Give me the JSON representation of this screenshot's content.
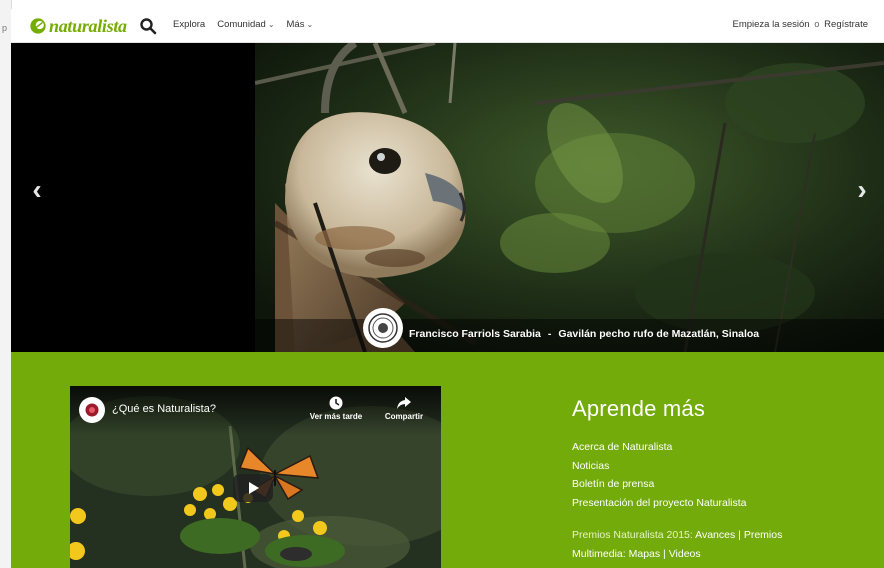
{
  "browser": {
    "edge_char": "p"
  },
  "header": {
    "logo_text": "naturalista",
    "nav": [
      {
        "label": "Explora",
        "dropdown": false
      },
      {
        "label": "Comunidad",
        "dropdown": true
      },
      {
        "label": "Más",
        "dropdown": true
      }
    ],
    "login": "Empieza la sesión",
    "or": "o",
    "signup": "Regístrate"
  },
  "hero": {
    "photographer": "Francisco Farriols Sarabia",
    "separator": "-",
    "description": "Gavilán pecho rufo de Mazatlán, Sinaloa",
    "prev_glyph": "‹",
    "next_glyph": "›"
  },
  "video": {
    "title": "¿Qué es Naturalista?",
    "watch_later": "Ver más tarde",
    "share": "Compartir"
  },
  "learn": {
    "heading": "Aprende más",
    "links": [
      "Acerca de Naturalista",
      "Noticias",
      "Boletín de prensa",
      "Presentación del proyecto Naturalista"
    ],
    "awards": {
      "label": "Premios Naturalista 2015:",
      "link1": "Avances",
      "link2": "Premios"
    },
    "multimedia": {
      "label": "Multimedia:",
      "link1": "Mapas",
      "link2": "Videos"
    },
    "divider": "|"
  },
  "colors": {
    "brand_green": "#74ac00",
    "section_green": "#73ab0b"
  }
}
